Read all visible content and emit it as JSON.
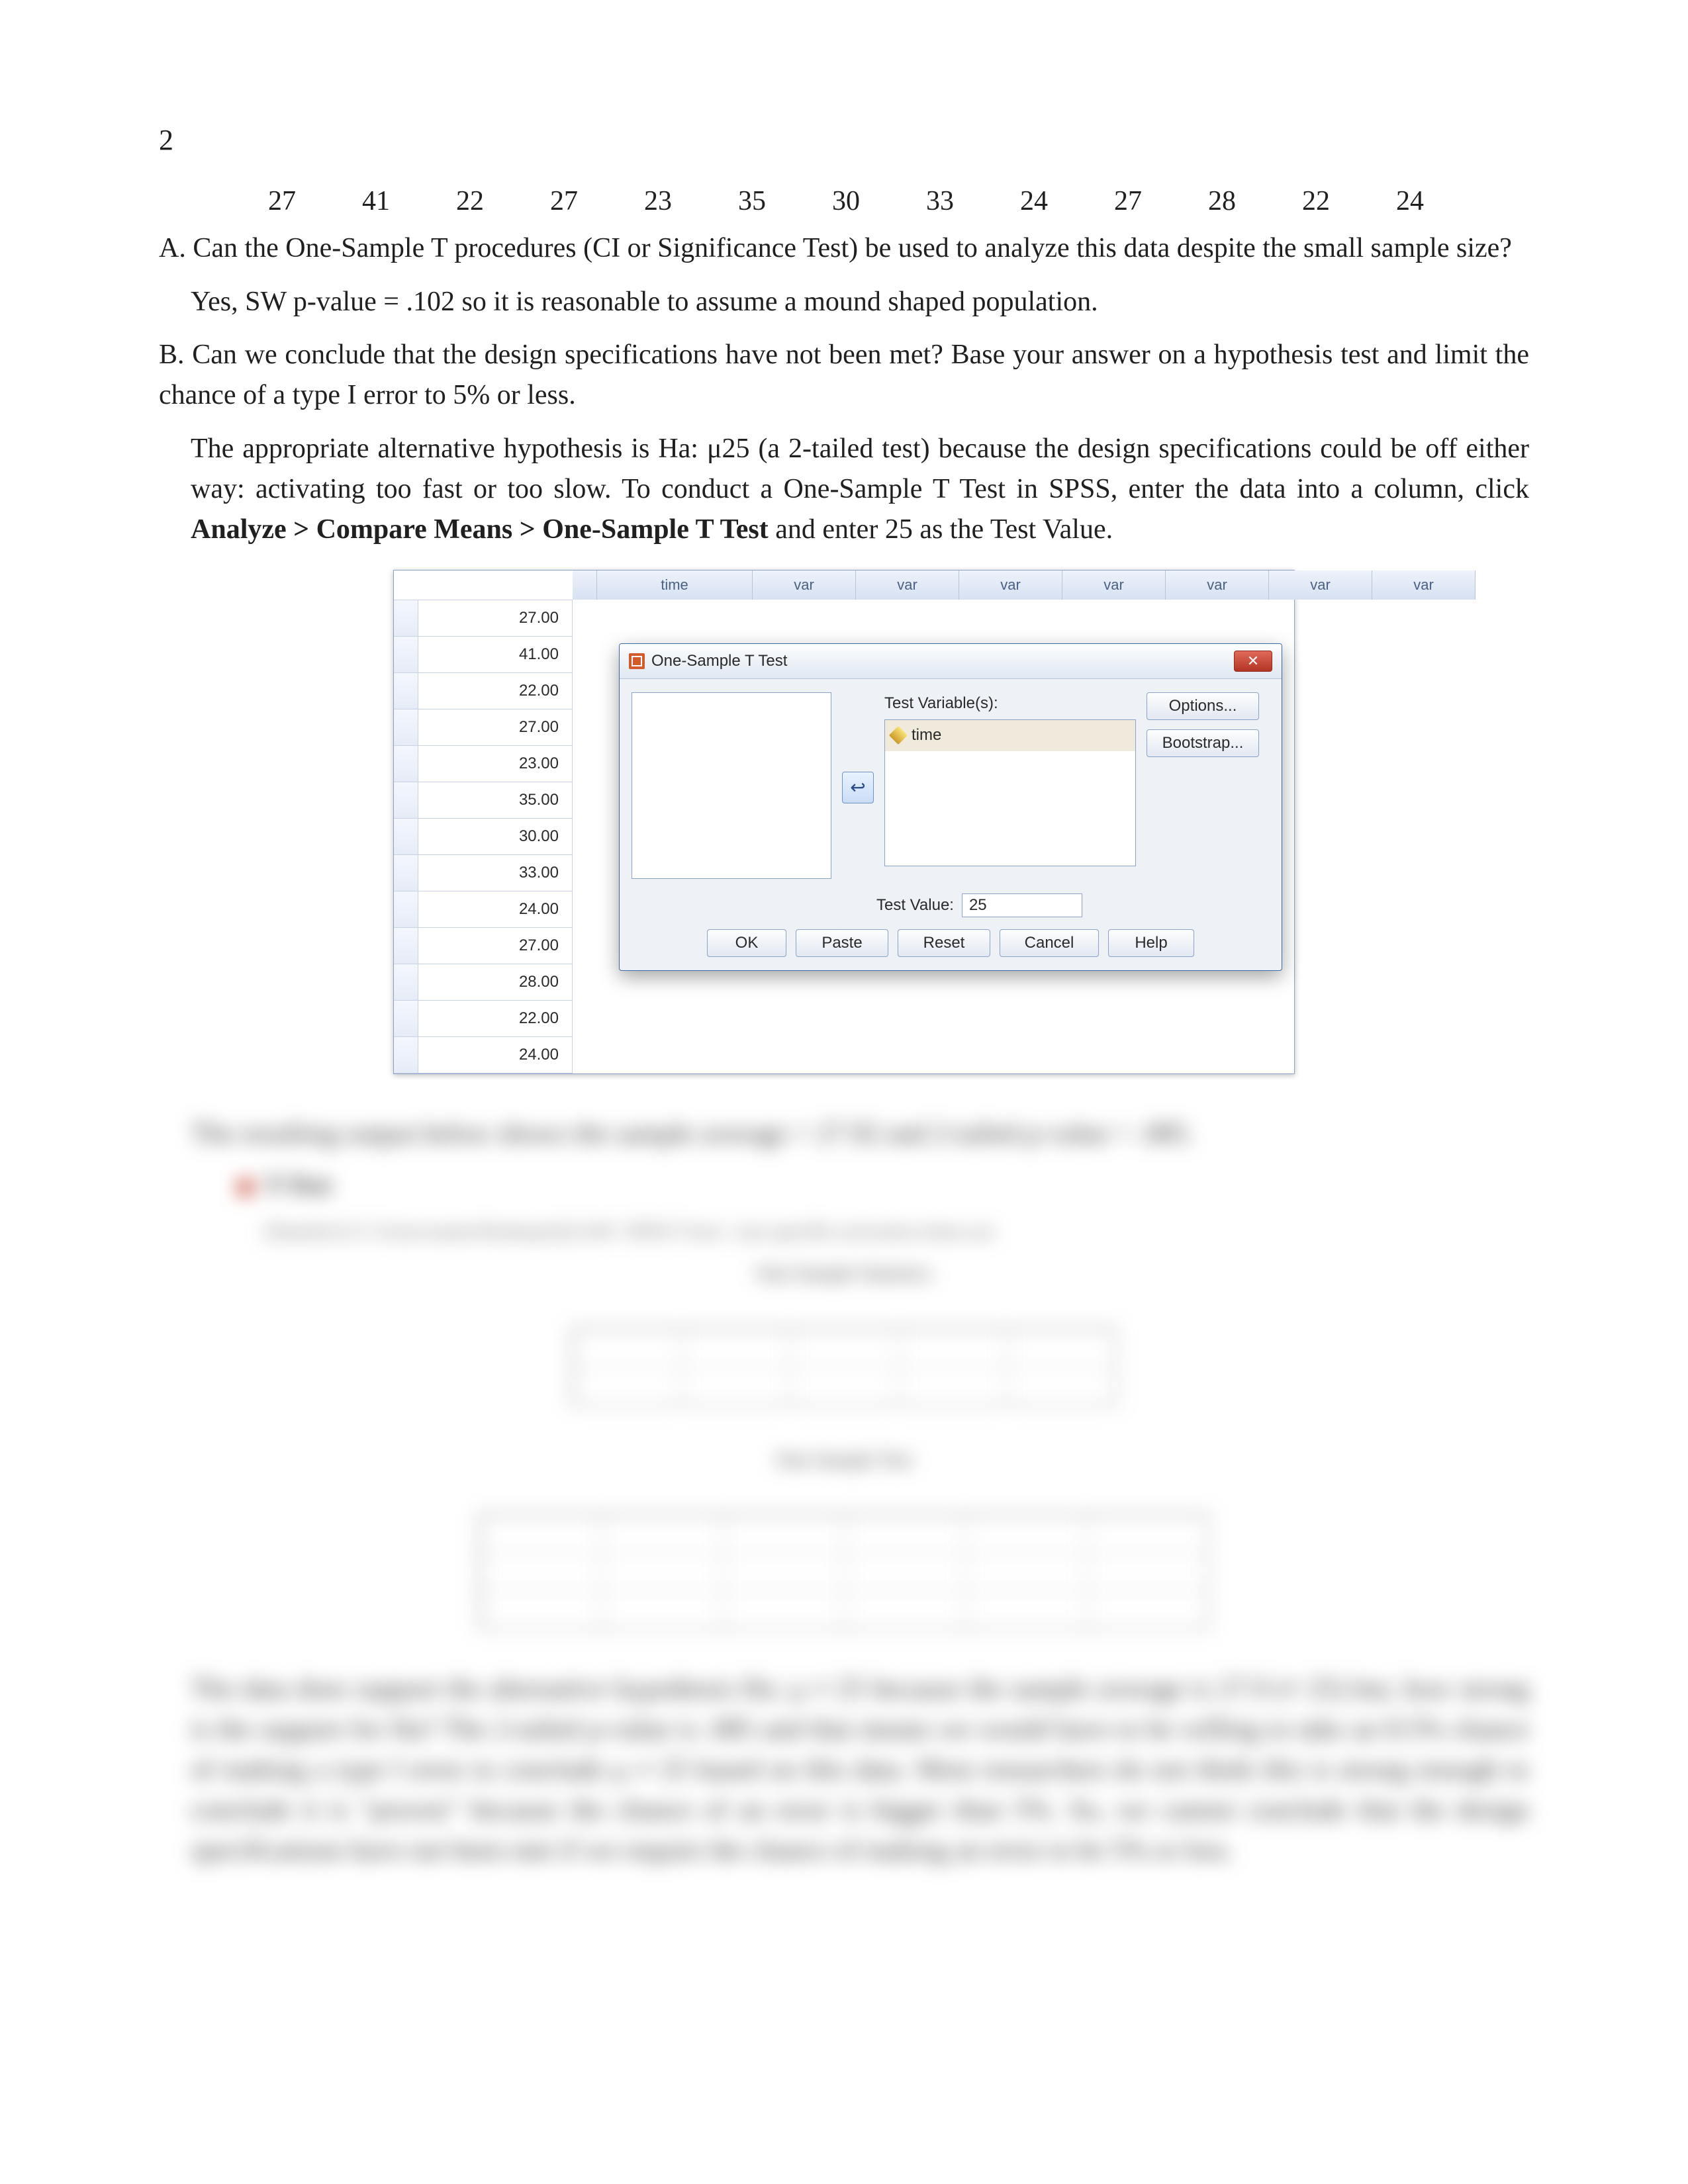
{
  "page_number": "2",
  "data_values": [
    "27",
    "41",
    "22",
    "27",
    "23",
    "35",
    "30",
    "33",
    "24",
    "27",
    "28",
    "22",
    "24"
  ],
  "q_a": {
    "prompt": "A. Can the One-Sample T procedures (CI or Significance Test) be used to analyze this data despite the small sample size?",
    "answer": "Yes, SW p-value = .102 so it is reasonable to assume a mound shaped population."
  },
  "q_b": {
    "prompt": "B. Can we conclude that the design specifications have not been met? Base your answer on a hypothesis test and limit the chance of a type I error to 5% or less.",
    "para_pre": "The appropriate alternative hypothesis is Ha: μ25 (a 2-tailed test) because the design specifications could be off either way: activating too fast or too slow. To conduct a One-Sample T Test in SPSS, enter the data into a column, click ",
    "bold_path": "Analyze > Compare Means > One-Sample T Test",
    "para_post": " and enter 25 as the Test Value."
  },
  "spss": {
    "col_header": "time",
    "empty_col": "var",
    "cells": [
      "27.00",
      "41.00",
      "22.00",
      "27.00",
      "23.00",
      "35.00",
      "30.00",
      "33.00",
      "24.00",
      "27.00",
      "28.00",
      "22.00",
      "24.00"
    ],
    "dialog_title": "One-Sample T Test",
    "close_glyph": "✕",
    "tv_label": "Test Variable(s):",
    "tv_item": "time",
    "options_btn": "Options...",
    "bootstrap_btn": "Bootstrap...",
    "arrow_glyph": "↩",
    "test_value_label": "Test Value:",
    "test_value": "25",
    "buttons": {
      "ok": "OK",
      "paste": "Paste",
      "reset": "Reset",
      "cancel": "Cancel",
      "help": "Help"
    }
  },
  "blurred": {
    "line1": "The resulting output below shows the sample average = 27.92 and 2-tailed p-value = .085.",
    "heading": "T-Test",
    "path_line": "[DataSet1] C:\\Users\\name\\Desktop\\Q2.SAV  /SPSS  T-test  / one-specfile  activation  times.sav",
    "caption1": "One-Sample Statistics",
    "caption2": "One-Sample Test",
    "para": "The data does support the alternative hypothesis Ha: μ ≠ 25 because the sample average is 27.9 (≠ 25) but, how strong is the support for Ha? The 2-tailed p-value is .085 and that means we would have to be willing to take an 8.5% chance of making a type I error to conclude μ ≠ 25 based on this data. Most researchers do not think this is strong enough to conclude it is \"proven\" because the chance of an error is bigger than 5%. So, we cannot conclude that the design specifications have not been met if we require the chance of making an error to be 5% or less."
  }
}
